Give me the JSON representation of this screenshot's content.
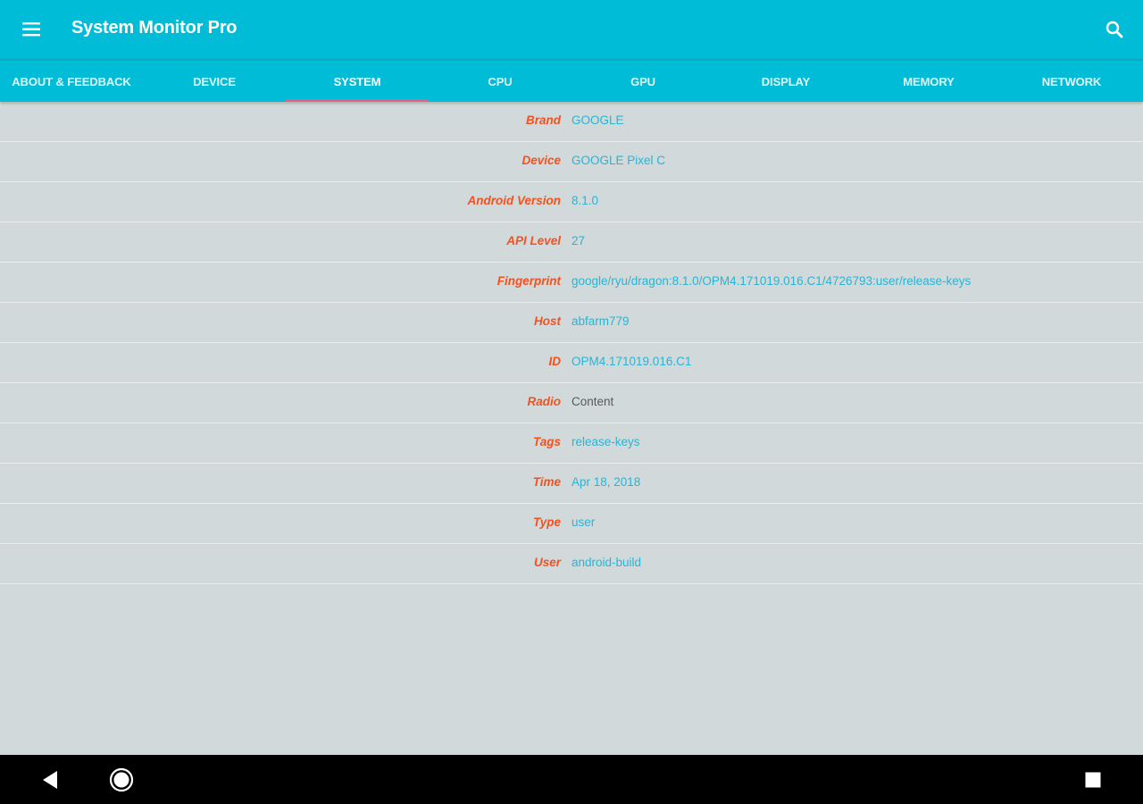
{
  "app": {
    "title": "System Monitor Pro",
    "accent_color": "#00bcd6",
    "indicator_color": "#ef5b85",
    "label_color": "#f4511e",
    "value_color": "#26b5d6"
  },
  "appbar": {
    "menu_icon": "hamburger-menu-icon",
    "search_icon": "search-icon"
  },
  "tabs": [
    {
      "label": "ABOUT & FEEDBACK"
    },
    {
      "label": "DEVICE"
    },
    {
      "label": "SYSTEM"
    },
    {
      "label": "CPU"
    },
    {
      "label": "GPU"
    },
    {
      "label": "DISPLAY"
    },
    {
      "label": "MEMORY"
    },
    {
      "label": "NETWORK"
    }
  ],
  "active_tab": "SYSTEM",
  "system_info": [
    {
      "label": "Brand",
      "value": "GOOGLE"
    },
    {
      "label": "Device",
      "value": "GOOGLE Pixel C"
    },
    {
      "label": "Android Version",
      "value": "8.1.0"
    },
    {
      "label": "API Level",
      "value": "27"
    },
    {
      "label": "Fingerprint",
      "value": "google/ryu/dragon:8.1.0/OPM4.171019.016.C1/4726793:user/release-keys"
    },
    {
      "label": "Host",
      "value": "abfarm779"
    },
    {
      "label": "ID",
      "value": "OPM4.171019.016.C1"
    },
    {
      "label": "Radio",
      "value": "Content"
    },
    {
      "label": "Tags",
      "value": "release-keys"
    },
    {
      "label": "Time",
      "value": "Apr 18, 2018"
    },
    {
      "label": "Type",
      "value": "user"
    },
    {
      "label": "User",
      "value": "android-build"
    }
  ],
  "navbar": {
    "back_icon": "back-triangle-icon",
    "home_icon": "home-circle-icon",
    "recents_icon": "recents-square-icon"
  }
}
